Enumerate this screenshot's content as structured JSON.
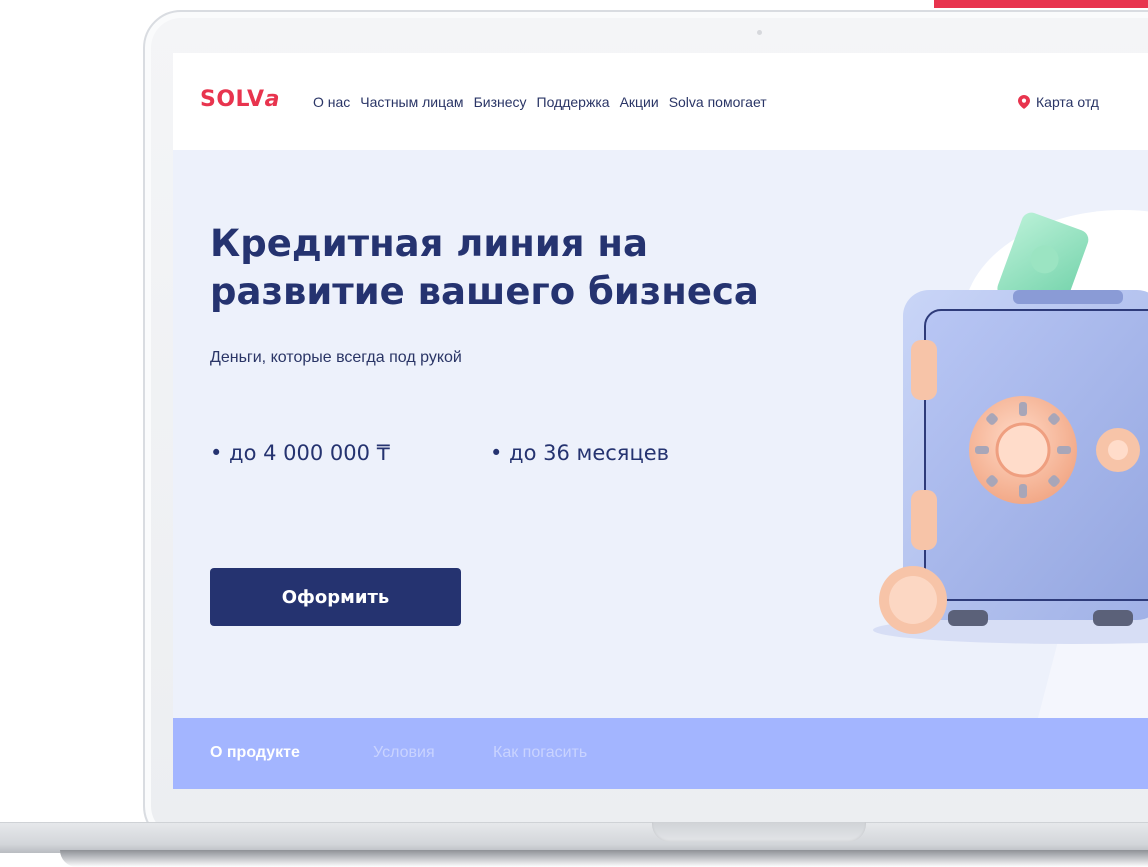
{
  "brand": {
    "logo_text": "SOLVa",
    "accent_color": "#e8344e",
    "primary_color": "#253370"
  },
  "nav": {
    "links": [
      "О нас",
      "Частным лицам",
      "Бизнесу",
      "Поддержка",
      "Акции",
      "Solva помогает"
    ],
    "map_link": "Карта отд",
    "map_icon": "map-pin-icon"
  },
  "hero": {
    "title_line_1": "Кредитная линия на",
    "title_line_2": "развитие вашего бизнеса",
    "subtitle": "Деньги, которые всегда под рукой",
    "features": [
      "• до 4 000 000 ₸",
      "• до 36 месяцев"
    ],
    "cta_label": "Оформить",
    "illustration": "safe-with-money-icon"
  },
  "tabs": {
    "items": [
      "О продукте",
      "Условия",
      "Как погасить"
    ],
    "active": "О продукте"
  }
}
